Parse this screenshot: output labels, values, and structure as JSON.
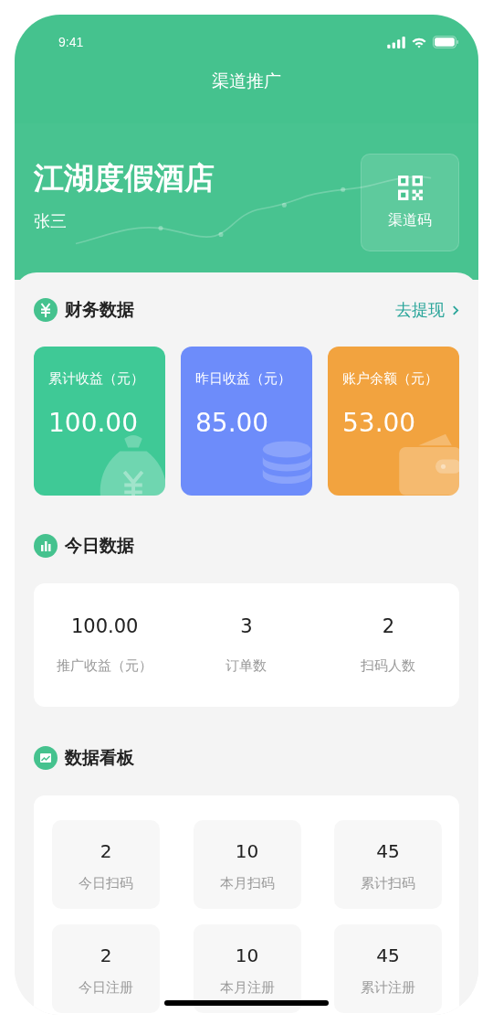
{
  "status_bar": {
    "time": "9:41"
  },
  "nav": {
    "title": "渠道推广"
  },
  "hero": {
    "name": "江湖度假酒店",
    "user": "张三",
    "qr_button": "渠道码"
  },
  "finance": {
    "title": "财务数据",
    "link": "去提现",
    "cards": [
      {
        "label": "累计收益（元）",
        "value": "100.00",
        "kind": "bag",
        "color": "#3fc996"
      },
      {
        "label": "昨日收益（元）",
        "value": "85.00",
        "kind": "coins",
        "color": "#6d8cfa"
      },
      {
        "label": "账户余额（元）",
        "value": "53.00",
        "kind": "wallet",
        "color": "#f2a33f"
      }
    ]
  },
  "today": {
    "title": "今日数据",
    "stats": [
      {
        "value": "100.00",
        "label": "推广收益（元）"
      },
      {
        "value": "3",
        "label": "订单数"
      },
      {
        "value": "2",
        "label": "扫码人数"
      }
    ]
  },
  "board": {
    "title": "数据看板",
    "tiles": [
      {
        "value": "2",
        "label": "今日扫码"
      },
      {
        "value": "10",
        "label": "本月扫码"
      },
      {
        "value": "45",
        "label": "累计扫码"
      },
      {
        "value": "2",
        "label": "今日注册"
      },
      {
        "value": "10",
        "label": "本月注册"
      },
      {
        "value": "45",
        "label": "累计注册"
      }
    ]
  }
}
